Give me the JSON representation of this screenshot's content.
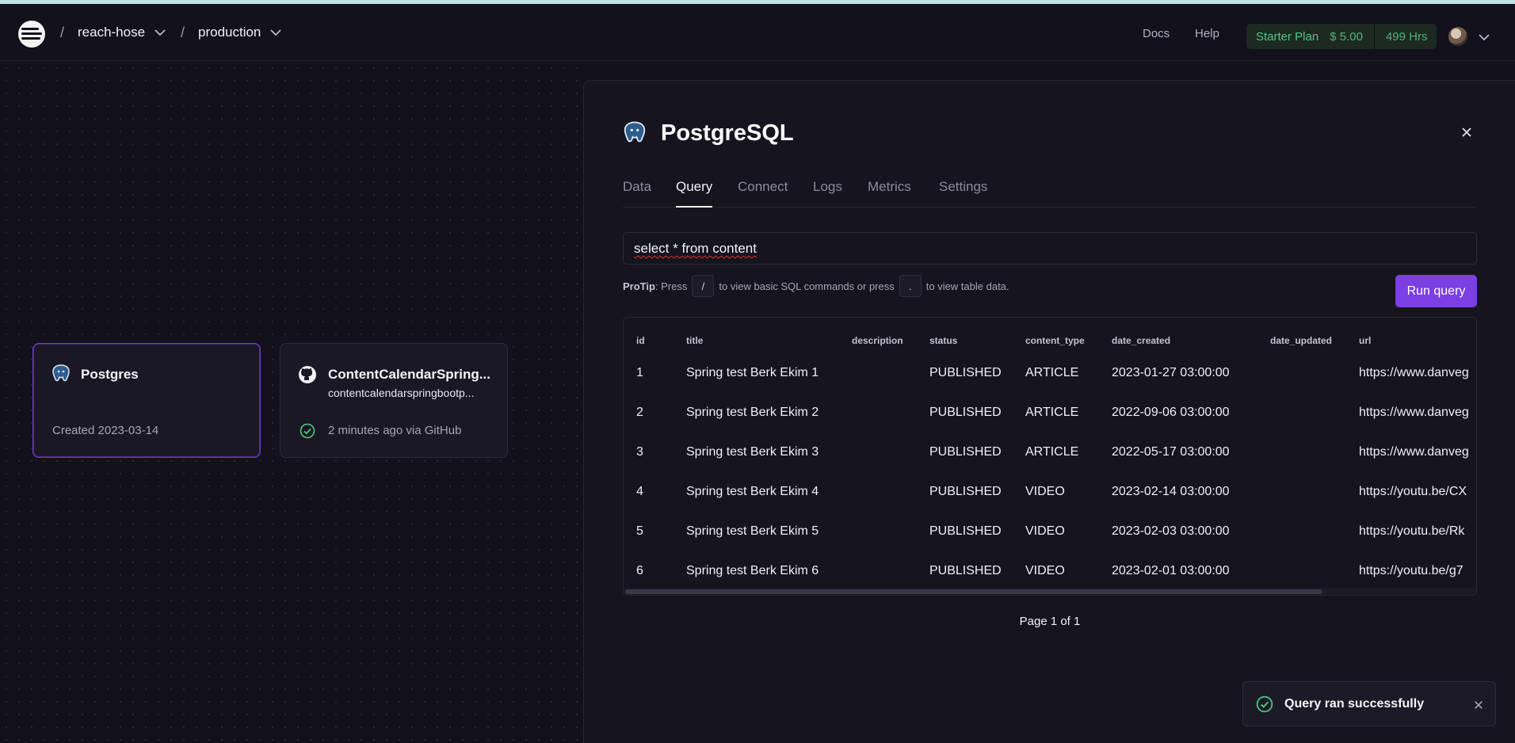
{
  "topbar": {
    "project": "reach-hose",
    "environment": "production",
    "docs": "Docs",
    "help": "Help",
    "plan": {
      "name": "Starter Plan",
      "credit": "$ 5.00",
      "hours": "499 Hrs"
    }
  },
  "canvas": {
    "postgres_card": {
      "name": "Postgres",
      "meta": "Created 2023-03-14"
    },
    "service_card": {
      "name": "ContentCalendarSpring...",
      "sub": "contentcalendarspringbootp...",
      "meta": "2 minutes ago via GitHub"
    }
  },
  "panel": {
    "title": "PostgreSQL",
    "tabs": [
      "Data",
      "Query",
      "Connect",
      "Logs",
      "Metrics",
      "Settings"
    ],
    "active_tab": "Query",
    "query": "select * from content",
    "protip": {
      "label": "ProTip",
      "t1": ": Press",
      "key1": "/",
      "t2": "to view basic SQL commands or press",
      "key2": ".",
      "t3": "to view table data."
    },
    "run_button": "Run query",
    "table": {
      "columns": [
        "id",
        "title",
        "description",
        "status",
        "content_type",
        "date_created",
        "date_updated",
        "url"
      ],
      "rows": [
        [
          "1",
          "Spring test Berk Ekim 1",
          "",
          "PUBLISHED",
          "ARTICLE",
          "2023-01-27 03:00:00",
          "",
          "https://www.danveg"
        ],
        [
          "2",
          "Spring test Berk Ekim 2",
          "",
          "PUBLISHED",
          "ARTICLE",
          "2022-09-06 03:00:00",
          "",
          "https://www.danveg"
        ],
        [
          "3",
          "Spring test Berk Ekim 3",
          "",
          "PUBLISHED",
          "ARTICLE",
          "2022-05-17 03:00:00",
          "",
          "https://www.danveg"
        ],
        [
          "4",
          "Spring test Berk Ekim 4",
          "",
          "PUBLISHED",
          "VIDEO",
          "2023-02-14 03:00:00",
          "",
          "https://youtu.be/CX"
        ],
        [
          "5",
          "Spring test Berk Ekim 5",
          "",
          "PUBLISHED",
          "VIDEO",
          "2023-02-03 03:00:00",
          "",
          "https://youtu.be/Rk"
        ],
        [
          "6",
          "Spring test Berk Ekim 6",
          "",
          "PUBLISHED",
          "VIDEO",
          "2023-02-01 03:00:00",
          "",
          "https://youtu.be/g7"
        ]
      ]
    },
    "page_info": "Page 1 of 1"
  },
  "toast": {
    "message": "Query ran successfully"
  },
  "colors": {
    "accent": "#7b3fe4",
    "success": "#4dc985",
    "background": "#13111c"
  },
  "icons": [
    "railway-logo-icon",
    "chevron-down-icon",
    "postgres-elephant-icon",
    "github-icon",
    "check-circle-icon",
    "close-icon"
  ]
}
